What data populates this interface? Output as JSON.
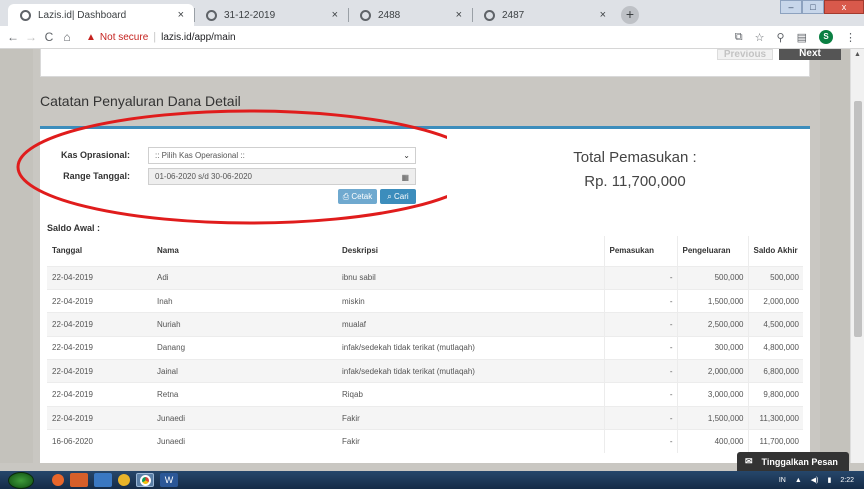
{
  "browser": {
    "tabs": [
      {
        "title": "Lazis.id| Dashboard",
        "close": "×"
      },
      {
        "title": "31-12-2019",
        "close": "×"
      },
      {
        "title": "2488",
        "close": "×"
      },
      {
        "title": "2487",
        "close": "×"
      }
    ],
    "new_tab": "+",
    "window_controls": {
      "min": "–",
      "max": "□",
      "close": "x"
    },
    "nav": {
      "back": "←",
      "forward": "→",
      "reload": "C",
      "home": "⌂"
    },
    "warning_icon": "▲",
    "security": "Not secure",
    "url_separator": "|",
    "url": "lazis.id/app/main",
    "right_icons": {
      "translate": "⧉",
      "star": "☆",
      "tools": "⚲",
      "docs": "▤",
      "profile": "S",
      "menu": "⋮"
    }
  },
  "pagination": {
    "previous": "Previous",
    "next": "Next"
  },
  "page_title": "Catatan Penyaluran Dana Detail",
  "form": {
    "kas_label": "Kas Oprasional:",
    "kas_value": ":: Pilih Kas Operasional ::",
    "kas_caret": "⌄",
    "range_label": "Range Tanggal:",
    "range_value": "01-06-2020 s/d 30-06-2020",
    "range_icon": "▦",
    "cetak_button": "Cetak",
    "cetak_icon": "⎙",
    "cari_button": "Cari",
    "cari_icon": "⌕"
  },
  "summary": {
    "total_label": "Total Pemasukan :",
    "total_value": "Rp. 11,700,000"
  },
  "annotation_color": "#e01c1c",
  "accent_color": "#3c8dbc",
  "saldo_awal_label": "Saldo Awal :",
  "table": {
    "headers": {
      "tanggal": "Tanggal",
      "nama": "Nama",
      "deskripsi": "Deskripsi",
      "pemasukan": "Pemasukan",
      "pengeluaran": "Pengeluaran",
      "saldo": "Saldo Akhir"
    },
    "rows": [
      {
        "tanggal": "22-04-2019",
        "nama": "Adi",
        "deskripsi": "ibnu sabil",
        "pemasukan": "-",
        "pengeluaran": "500,000",
        "saldo": "500,000"
      },
      {
        "tanggal": "22-04-2019",
        "nama": "Inah",
        "deskripsi": "miskin",
        "pemasukan": "-",
        "pengeluaran": "1,500,000",
        "saldo": "2,000,000"
      },
      {
        "tanggal": "22-04-2019",
        "nama": "Nuriah",
        "deskripsi": "mualaf",
        "pemasukan": "-",
        "pengeluaran": "2,500,000",
        "saldo": "4,500,000"
      },
      {
        "tanggal": "22-04-2019",
        "nama": "Danang",
        "deskripsi": "infak/sedekah tidak terikat (mutlaqah)",
        "pemasukan": "-",
        "pengeluaran": "300,000",
        "saldo": "4,800,000"
      },
      {
        "tanggal": "22-04-2019",
        "nama": "Jainal",
        "deskripsi": "infak/sedekah tidak terikat (mutlaqah)",
        "pemasukan": "-",
        "pengeluaran": "2,000,000",
        "saldo": "6,800,000"
      },
      {
        "tanggal": "22-04-2019",
        "nama": "Retna",
        "deskripsi": "Riqab",
        "pemasukan": "-",
        "pengeluaran": "3,000,000",
        "saldo": "9,800,000"
      },
      {
        "tanggal": "22-04-2019",
        "nama": "Junaedi",
        "deskripsi": "Fakir",
        "pemasukan": "-",
        "pengeluaran": "1,500,000",
        "saldo": "11,300,000"
      },
      {
        "tanggal": "16-06-2020",
        "nama": "Junaedi",
        "deskripsi": "Fakir",
        "pemasukan": "-",
        "pengeluaran": "400,000",
        "saldo": "11,700,000"
      }
    ]
  },
  "chat": {
    "label": "Tinggalkan Pesan",
    "icon": "✉"
  },
  "taskbar": {
    "tray_lang": "IN",
    "tray_up": "▲",
    "tray_volume": "◀)",
    "tray_network": "▮",
    "clock": "2:22"
  }
}
